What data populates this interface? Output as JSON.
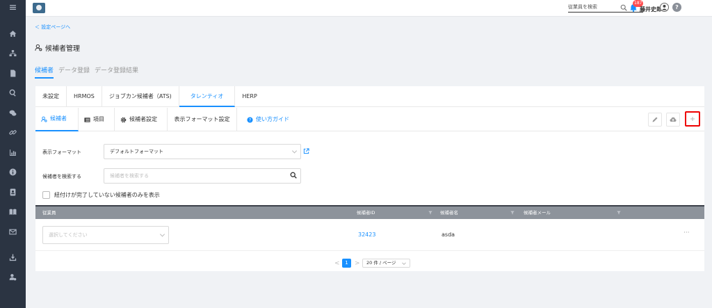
{
  "topbar": {
    "search_placeholder": "従業員を検索",
    "notification_count": "187",
    "user_name": "藤井史郎",
    "help_symbol": "?"
  },
  "sidebar": {
    "icons": [
      "menu-icon",
      "home-icon",
      "org-chart-icon",
      "document-icon",
      "search-icon",
      "chat-icon",
      "link-icon",
      "chart-icon",
      "info-icon",
      "contacts-icon",
      "book-icon",
      "mail-icon",
      "download-icon",
      "user-settings-icon"
    ]
  },
  "breadcrumb": {
    "back_label": "＜ 設定ページへ"
  },
  "page": {
    "title": "候補者管理"
  },
  "sub_tabs": [
    {
      "label": "候補者",
      "active": true
    },
    {
      "label": "データ登録",
      "active": false
    },
    {
      "label": "データ登録結果",
      "active": false
    }
  ],
  "integration_tabs": [
    {
      "label": "未設定",
      "active": false
    },
    {
      "label": "HRMOS",
      "active": false
    },
    {
      "label": "ジョブカン候補者（ATS)",
      "active": false
    },
    {
      "label": "タレンティオ",
      "active": true
    },
    {
      "label": "HERP",
      "active": false
    }
  ],
  "inner_tabs": {
    "candidates": "候補者",
    "items": "項目",
    "settings": "候補者設定",
    "display_format": "表示フォーマット設定",
    "guide": "使い方ガイド"
  },
  "form": {
    "display_format_label": "表示フォーマット",
    "display_format_value": "デフォルトフォーマット",
    "search_label": "候補者を検索する",
    "search_placeholder": "候補者を検索する",
    "checkbox_label": "紐付けが完了していない候補者のみを表示"
  },
  "table": {
    "columns": [
      "従業員",
      "候補者ID",
      "候補者名",
      "候補者メール"
    ],
    "rows": [
      {
        "employee_placeholder": "選択してください",
        "candidate_id": "32423",
        "candidate_name": "asda",
        "candidate_email": "",
        "menu": "···"
      }
    ]
  },
  "pagination": {
    "prev": "<",
    "current": "1",
    "next": ">",
    "page_size": "20 件 / ページ"
  },
  "colors": {
    "accent": "#1890ff",
    "sidebar": "#2b3442",
    "highlight_border": "#ee0000"
  }
}
